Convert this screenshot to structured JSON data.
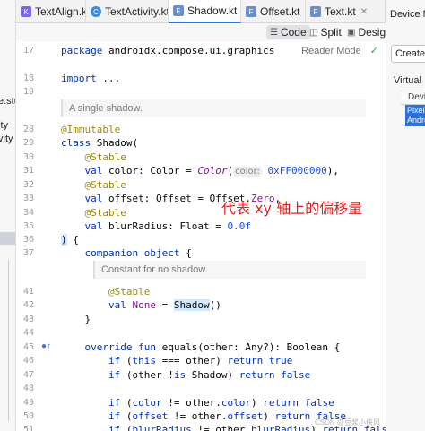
{
  "tabs": [
    {
      "label": "TextAlign.kt",
      "icon": "compose-file-icon"
    },
    {
      "label": "TextActivity.kt",
      "icon": "class-file-icon"
    },
    {
      "label": "Shadow.kt",
      "icon": "kotlin-file-icon",
      "active": true
    },
    {
      "label": "Offset.kt",
      "icon": "kotlin-file-icon"
    },
    {
      "label": "Text.kt",
      "icon": "kotlin-file-icon"
    }
  ],
  "view_modes": {
    "code": "Code",
    "split": "Split",
    "design": "Design"
  },
  "reader_mode": "Reader Mode",
  "project_tree": {
    "item1": "e.stu",
    "item2": "ity",
    "item3": "vity"
  },
  "right_panel": {
    "title": "Device Ma",
    "create_label": "Create",
    "tab_virtual": "Virtual",
    "col_header": "Devi",
    "device_name_1": "Pixel",
    "device_name_2": "Andro"
  },
  "gutter_lines": {
    "l17": "17",
    "l18": "18",
    "l19": "19",
    "l28": "28",
    "l29": "29",
    "l30": "30",
    "l31": "31",
    "l32": "32",
    "l33": "33",
    "l34": "34",
    "l35": "35",
    "l36": "36",
    "l37": "37",
    "l41": "41",
    "l42": "42",
    "l43": "43",
    "l44": "44",
    "l45": "45",
    "l46": "46",
    "l47": "47",
    "l48": "48",
    "l49": "49",
    "l50": "50",
    "l51": "51"
  },
  "code": {
    "package_kw": "package",
    "package_name": " androidx.compose.ui.graphics",
    "import_kw": "import",
    "import_rest": " ...",
    "doc_class": "A single shadow.",
    "immutable": "@Immutable",
    "class_kw": "class",
    "class_name": " Shadow(",
    "stable": "@Stable",
    "val_kw": "val",
    "color_decl": " color: Color = ",
    "color_fn": "Color",
    "color_open": "(",
    "color_hint": "color:",
    "color_value": "0xFF000000",
    "color_close": "),",
    "offset_decl": " offset: Offset = Offset.",
    "offset_zero": "Zero",
    "offset_end": ",",
    "blur_decl": " blurRadius: Float = ",
    "blur_value": "0.0f",
    "close_paren": ")",
    "class_brace": " {",
    "companion_kw": "companion object",
    "companion_open": " {",
    "doc_none": "Constant for no shadow.",
    "none_kw": "val",
    "none_name": " None",
    "none_eq": " = ",
    "none_fn": "Shadow",
    "none_call": "()",
    "close_brace": "}",
    "override_kw": "override fun",
    "equals_sig": " equals(other: Any?): Boolean {",
    "if_kw": "if",
    "this_kw": "this",
    "return_kw": "return",
    "true_kw": "true",
    "false_kw": "false",
    "eq_this_a": " (",
    "eq_this_b": " === other) ",
    "is_a": " (other !",
    "is_kw": "is",
    "is_b": " Shadow) ",
    "cmp_open": " (",
    "color_f": "color",
    "color_mid": " != other.",
    "cmp_close": ") ",
    "offset_f": "offset",
    "blur_f": "blurRadius"
  },
  "annotation": "代表 xy 轴上的偏移量",
  "watermark": "CSDN @豆浆小侠风"
}
